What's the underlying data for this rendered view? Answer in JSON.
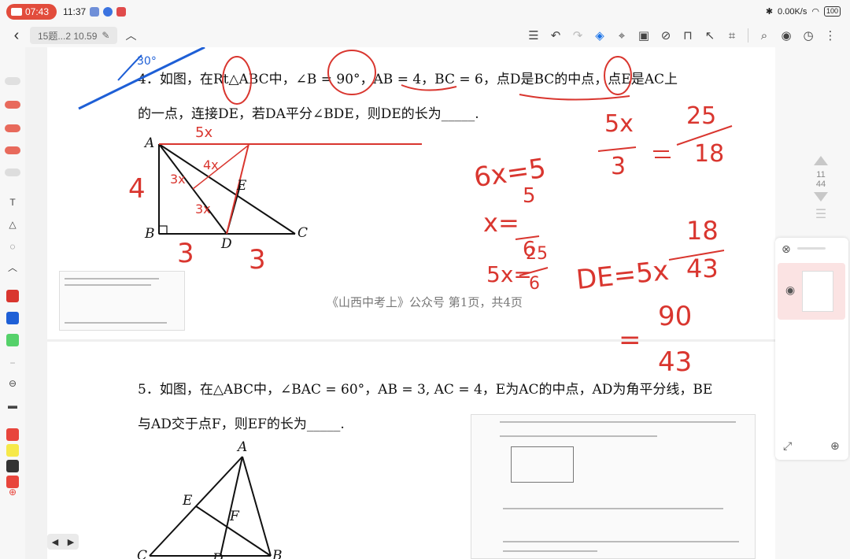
{
  "status_bar": {
    "recording_time": "07:43",
    "clock": "11:37",
    "network_speed": "0.00K/s",
    "battery": "100"
  },
  "toolbar": {
    "document_title": "15题...2 10.59",
    "tool_icons": [
      "list-icon",
      "undo-icon",
      "redo-icon",
      "layers-icon",
      "lasso-icon",
      "image-icon",
      "eye-off-icon",
      "lock-icon",
      "pointer-icon",
      "crop-icon",
      "search-doc-icon",
      "record-icon",
      "history-icon",
      "more-icon"
    ]
  },
  "colors": {
    "ink_red": "#d9362f",
    "swatches": [
      "#d9362f",
      "#1e5fd6",
      "#55d16a",
      "#000000",
      "#e8453c",
      "#f6e94a",
      "#333333",
      "#e8453c"
    ]
  },
  "q4": {
    "line1_prefix": "4．如图，在Rt△ABC中，∠B = 90°，AB = 4，BC = 6，点D是BC的中点，点E是AC上",
    "line2": "的一点，连接DE，若DA平分∠BDE，则DE的长为_____."
  },
  "q4_figure": {
    "labels": {
      "A": "A",
      "B": "B",
      "C": "C",
      "D": "D",
      "E": "E"
    }
  },
  "q4_ink": {
    "side_ab": "4",
    "bd": "3",
    "dc": "3",
    "seg_5x": "5x",
    "seg_4x": "4x",
    "seg_3x_1": "3x",
    "seg_3x_2": "3x",
    "eq1_lhs": "5x",
    "eq1_den": "3",
    "eq1_rhs_num": "25",
    "eq1_rhs_den": "18",
    "eq2": "6x=5",
    "eq3_lhs": "x=",
    "eq3_num": "5",
    "eq3_den": "6",
    "eq4_lhs": "5x=",
    "eq4_num": "25",
    "eq4_den": "6",
    "eq5_lhs": "DE=5x",
    "eq5_num": "18",
    "eq5_den": "43",
    "eq6_num": "90",
    "eq6_den": "43",
    "corner_30": "30°"
  },
  "footer": {
    "text": "《山西中考上》公众号    第1页，共4页"
  },
  "q5": {
    "line1": "5．如图，在△ABC中，∠BAC = 60°，AB = 3, AC = 4，E为AC的中点，AD为角平分线，BE",
    "line2": "与AD交于点F，则EF的长为_____."
  },
  "q5_figure": {
    "labels": {
      "A": "A",
      "E": "E",
      "F": "F",
      "C": "C",
      "D": "D",
      "B": "B"
    }
  },
  "right_panel": {
    "page_current": "11",
    "page_total": "44"
  }
}
